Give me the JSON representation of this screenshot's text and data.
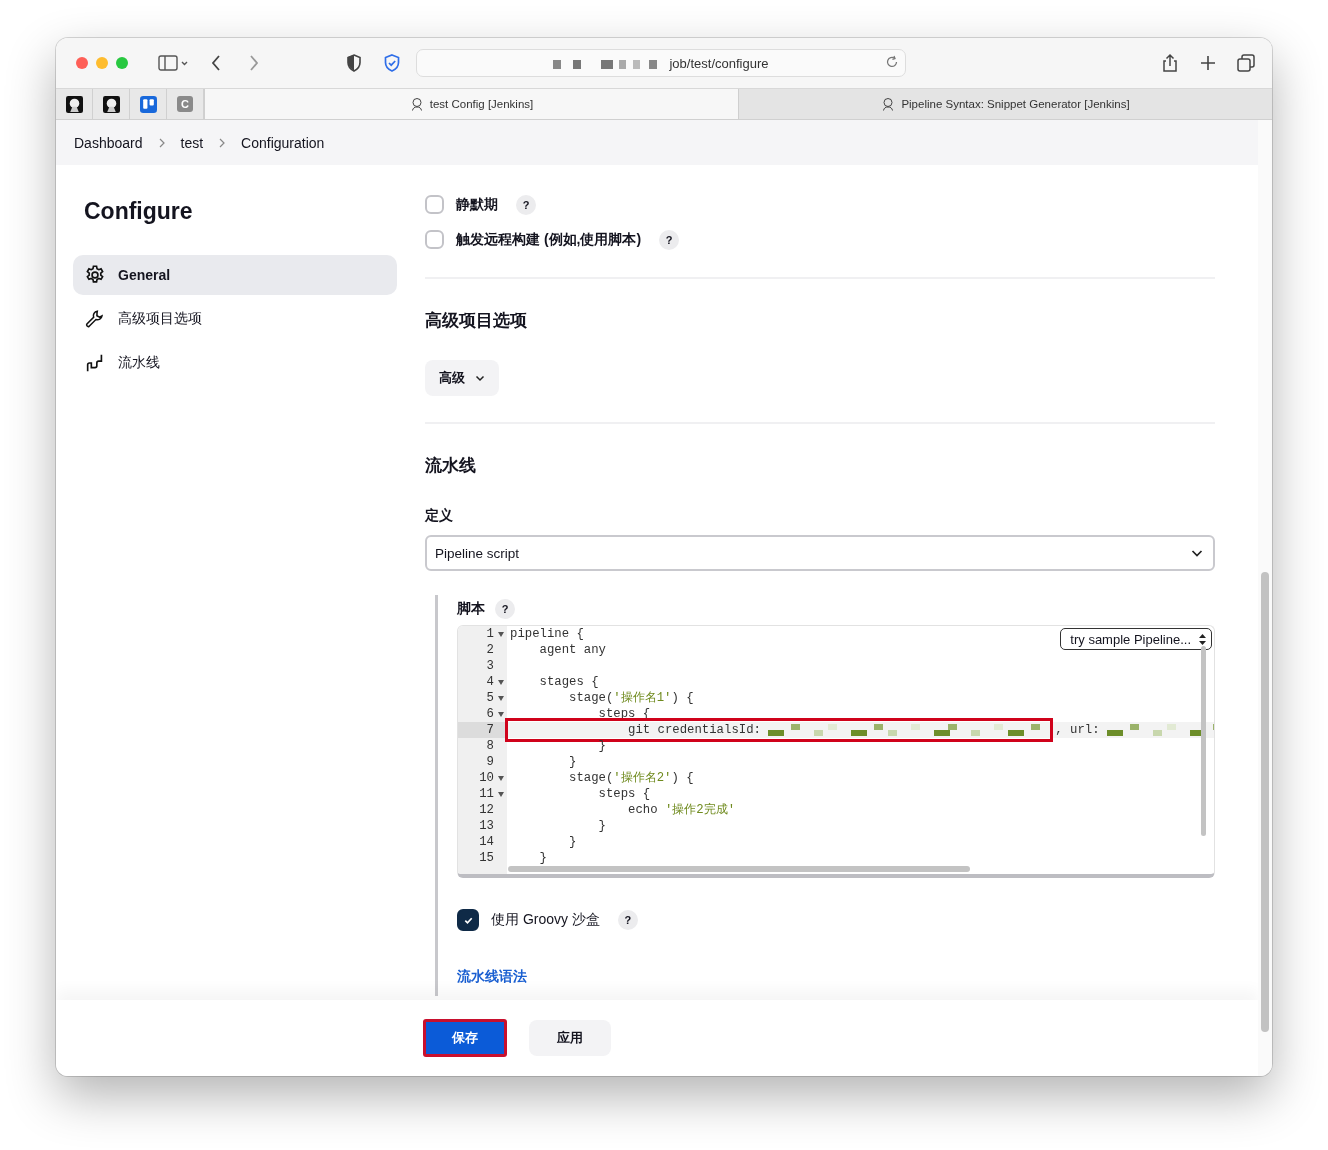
{
  "browser": {
    "address": "job/test/configure",
    "pinned_tabs": [
      {
        "kind": "jenkins"
      },
      {
        "kind": "jenkins"
      },
      {
        "kind": "board"
      },
      {
        "kind": "letter",
        "label": "C"
      }
    ],
    "tabs": [
      {
        "label": "test Config [Jenkins]",
        "selected": true
      },
      {
        "label": "Pipeline Syntax: Snippet Generator [Jenkins]",
        "selected": false
      }
    ]
  },
  "breadcrumbs": [
    "Dashboard",
    "test",
    "Configuration"
  ],
  "sidebar": {
    "title": "Configure",
    "items": [
      {
        "label": "General",
        "kind": "gear",
        "selected": true
      },
      {
        "label": "高级项目选项",
        "kind": "wrench",
        "selected": false
      },
      {
        "label": "流水线",
        "kind": "pipe",
        "selected": false
      }
    ]
  },
  "triggers": [
    {
      "label": "静默期",
      "checked": false,
      "help": "?"
    },
    {
      "label": "触发远程构建 (例如,使用脚本)",
      "checked": false,
      "help": "?"
    }
  ],
  "advanced_section": {
    "title": "高级项目选项",
    "button": "高级"
  },
  "pipeline_section": {
    "title": "流水线",
    "definition_label": "定义",
    "definition": "Pipeline script",
    "script_label": "脚本",
    "script_help": "?",
    "sample_select": "try sample Pipeline...",
    "lines": [
      {
        "number": "1",
        "fold": true,
        "active": false,
        "segments": [
          {
            "kind": "plain",
            "text": "pipeline {"
          }
        ]
      },
      {
        "number": "2",
        "fold": false,
        "active": false,
        "segments": [
          {
            "kind": "plain",
            "text": "    agent any"
          }
        ]
      },
      {
        "number": "3",
        "fold": false,
        "active": false
      },
      {
        "number": "4",
        "fold": true,
        "active": false,
        "segments": [
          {
            "kind": "plain",
            "text": "    stages {"
          }
        ]
      },
      {
        "number": "5",
        "fold": true,
        "active": false,
        "segments": [
          {
            "kind": "plain",
            "text": "        stage("
          },
          {
            "kind": "string",
            "text": "'操作名1'"
          },
          {
            "kind": "plain",
            "text": ") {"
          }
        ]
      },
      {
        "number": "6",
        "fold": true,
        "active": false,
        "segments": [
          {
            "kind": "plain",
            "text": "            steps {"
          }
        ]
      },
      {
        "number": "7",
        "fold": false,
        "active": true,
        "boxed_segments": [
          {
            "kind": "plain",
            "text": "                git credentialsId: "
          },
          {
            "kind": "redacted"
          }
        ],
        "segments": [
          {
            "kind": "plain",
            "text": ", url: "
          },
          {
            "kind": "redacted"
          }
        ]
      },
      {
        "number": "8",
        "fold": false,
        "active": false,
        "segments": [
          {
            "kind": "plain",
            "text": "            }"
          }
        ]
      },
      {
        "number": "9",
        "fold": false,
        "active": false,
        "segments": [
          {
            "kind": "plain",
            "text": "        }"
          }
        ]
      },
      {
        "number": "10",
        "fold": true,
        "active": false,
        "segments": [
          {
            "kind": "plain",
            "text": "        stage("
          },
          {
            "kind": "string",
            "text": "'操作名2'"
          },
          {
            "kind": "plain",
            "text": ") {"
          }
        ]
      },
      {
        "number": "11",
        "fold": true,
        "active": false,
        "segments": [
          {
            "kind": "plain",
            "text": "            steps {"
          }
        ]
      },
      {
        "number": "12",
        "fold": false,
        "active": false,
        "segments": [
          {
            "kind": "plain",
            "text": "                echo "
          },
          {
            "kind": "string",
            "text": "'操作2完成'"
          }
        ]
      },
      {
        "number": "13",
        "fold": false,
        "active": false,
        "segments": [
          {
            "kind": "plain",
            "text": "            }"
          }
        ]
      },
      {
        "number": "14",
        "fold": false,
        "active": false,
        "segments": [
          {
            "kind": "plain",
            "text": "        }"
          }
        ]
      },
      {
        "number": "15",
        "fold": false,
        "active": false,
        "segments": [
          {
            "kind": "plain",
            "text": "    }"
          }
        ]
      }
    ],
    "sandbox": {
      "label": "使用 Groovy 沙盒",
      "checked": true,
      "help": "?"
    },
    "syntax_link": "流水线语法"
  },
  "footer": {
    "buttons": [
      {
        "label": "保存",
        "kind": "primary",
        "boxed": true
      },
      {
        "label": "应用",
        "kind": "secondary",
        "boxed": false
      }
    ]
  }
}
